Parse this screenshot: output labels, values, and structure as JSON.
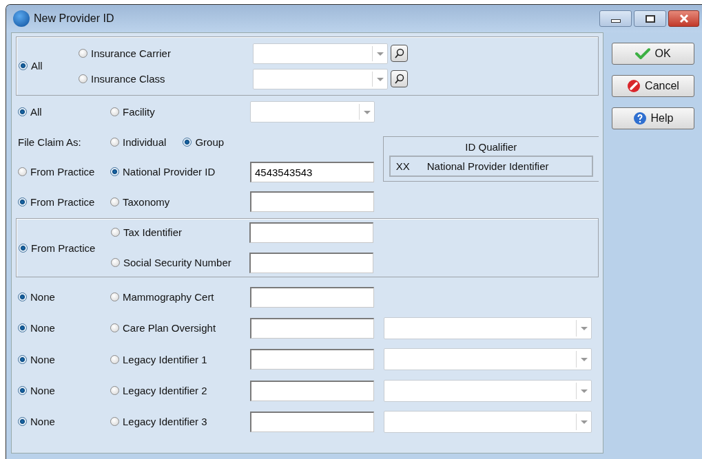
{
  "window": {
    "title": "New Provider ID"
  },
  "payer_section": {
    "default_option": {
      "label": "All",
      "selected": true
    },
    "options": [
      {
        "label": "Insurance Carrier",
        "selected": false
      },
      {
        "label": "Insurance Class",
        "selected": false
      }
    ]
  },
  "facility_row": {
    "default_option": {
      "label": "All",
      "selected": true
    },
    "option": {
      "label": "Facility",
      "selected": false
    }
  },
  "file_claim_as": {
    "label": "File Claim As:",
    "options": [
      {
        "label": "Individual",
        "selected": false
      },
      {
        "label": "Group",
        "selected": true
      }
    ]
  },
  "id_rows": [
    {
      "default_option": {
        "label": "From Practice",
        "selected": false
      },
      "option": {
        "label": "National Provider ID",
        "selected": true
      },
      "value": "4543543543"
    },
    {
      "default_option": {
        "label": "From Practice",
        "selected": true
      },
      "option": {
        "label": "Taxonomy",
        "selected": false
      }
    }
  ],
  "id_qualifier": {
    "title": "ID Qualifier",
    "code": "XX",
    "description": "National Provider Identifier"
  },
  "tax_section": {
    "default_option": {
      "label": "From Practice",
      "selected": true
    },
    "options": [
      {
        "label": "Tax Identifier",
        "selected": false
      },
      {
        "label": "Social Security Number",
        "selected": false
      }
    ]
  },
  "other_rows": [
    {
      "kind": "field",
      "default_option": {
        "label": "None",
        "selected": true
      },
      "option": {
        "label": "Mammography Cert",
        "selected": false
      }
    },
    {
      "kind": "field_dropdown",
      "default_option": {
        "label": "None",
        "selected": true
      },
      "option": {
        "label": "Care Plan Oversight",
        "selected": false
      }
    },
    {
      "kind": "field_dropdown",
      "default_option": {
        "label": "None",
        "selected": true
      },
      "option": {
        "label": "Legacy Identifier 1",
        "selected": false
      }
    },
    {
      "kind": "field_dropdown",
      "default_option": {
        "label": "None",
        "selected": true
      },
      "option": {
        "label": "Legacy Identifier 2",
        "selected": false
      }
    },
    {
      "kind": "field_dropdown",
      "default_option": {
        "label": "None",
        "selected": true
      },
      "option": {
        "label": "Legacy Identifier 3",
        "selected": false
      }
    }
  ],
  "buttons": [
    {
      "kind": "ok",
      "label": "OK"
    },
    {
      "kind": "cancel",
      "label": "Cancel"
    },
    {
      "kind": "help",
      "label": "Help"
    }
  ]
}
